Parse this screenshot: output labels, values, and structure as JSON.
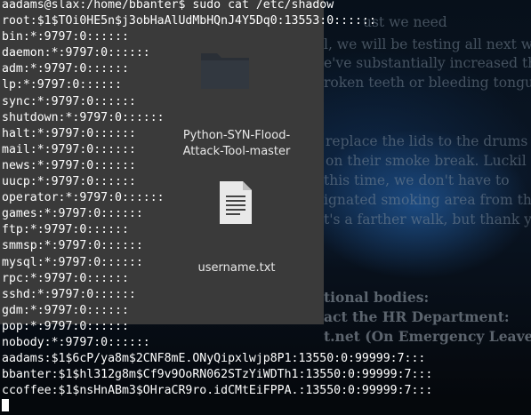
{
  "terminal": {
    "prompt": "aadams@slax:/home/bbanter$ sudo cat /etc/shadow",
    "lines": [
      "root:$1$TOi0HE5n$j3obHaAlUdMbHQnJ4Y5Dq0:13553:0::::::",
      "bin:*:9797:0::::::",
      "daemon:*:9797:0::::::",
      "adm:*:9797:0::::::",
      "lp:*:9797:0::::::",
      "sync:*:9797:0::::::",
      "shutdown:*:9797:0::::::",
      "halt:*:9797:0::::::",
      "mail:*:9797:0::::::",
      "news:*:9797:0::::::",
      "uucp:*:9797:0::::::",
      "operator:*:9797:0::::::",
      "games:*:9797:0::::::",
      "ftp:*:9797:0::::::",
      "smmsp:*:9797:0::::::",
      "mysql:*:9797:0::::::",
      "rpc:*:9797:0::::::",
      "sshd:*:9797:0::::::",
      "gdm:*:9797:0::::::",
      "pop:*:9797:0::::::",
      "nobody:*:9797:0::::::",
      "aadams:$1$6cP/ya8m$2CNF8mE.ONyQipxlwjp8P1:13550:0:99999:7:::",
      "bbanter:$1$hl312g8m$Cf9v9OoRN062STzYiWDTh1:13550:0:99999:7:::",
      "ccoffee:$1$nsHnABm3$OHraCR9ro.idCMtEiFPPA.:13550:0:99999:7:::"
    ]
  },
  "file_manager": {
    "folder_label_line1": "Python-SYN-Flood-",
    "folder_label_line2": "Attack-Tool-master",
    "file_label": "username.txt",
    "folder_icon": "folder-icon",
    "file_icon": "text-file-icon"
  },
  "background_page": {
    "l1": "ust we need",
    "l2": "l, we will be testing all next w",
    "l3": "e've substantially increased th",
    "l4": "roken teeth or bleeding tongu",
    "l5": "replace the lids to the drums",
    "l6": "on their smoke break. Luckil",
    "l7": "this time, we don't have to",
    "l8": "ignated smoking area from the",
    "l9": "t's a farther walk, but thank y",
    "l10": "tional bodies:",
    "l11": "act the HR Department:",
    "l12": "t.net (On Emergency Leave)"
  },
  "colors": {
    "terminal_text": "#ffffff",
    "file_manager_bg": "#3a3a3a",
    "background_tint": "#0a1626"
  }
}
